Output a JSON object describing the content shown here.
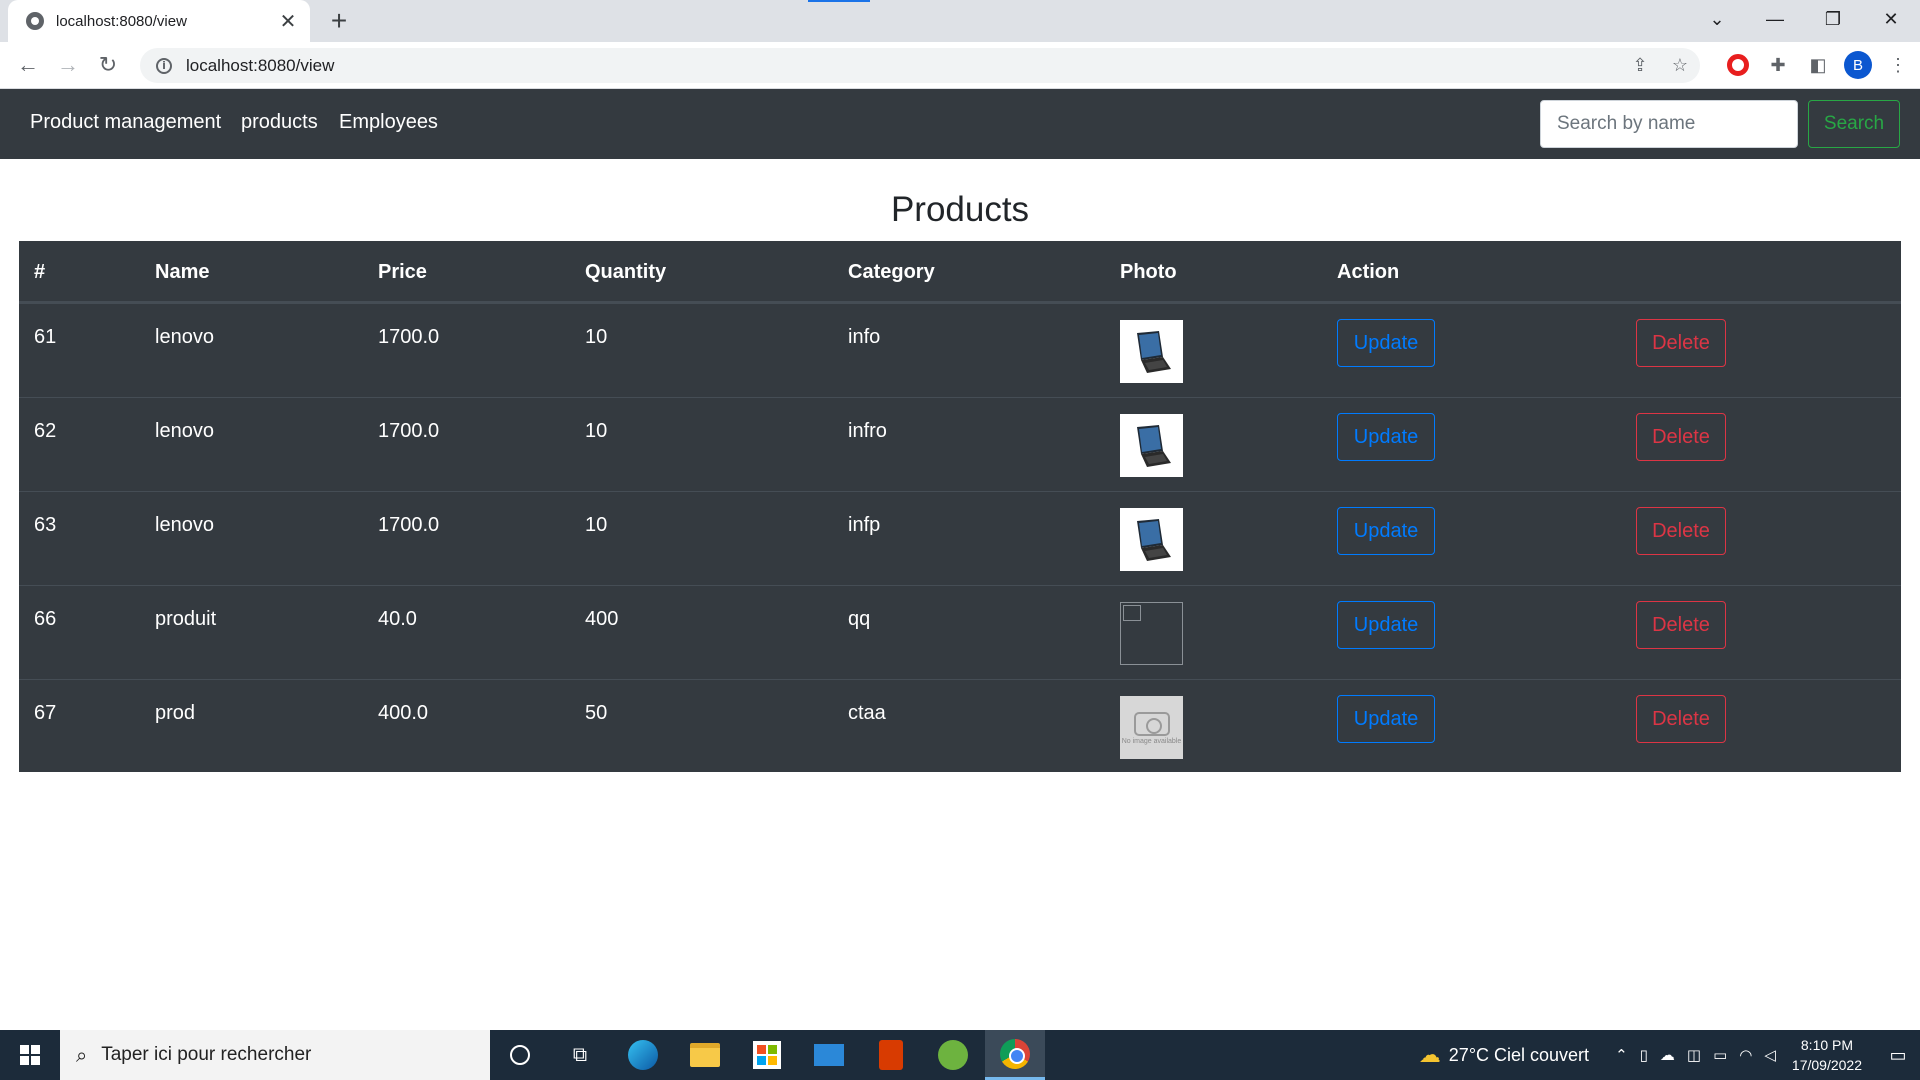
{
  "browser": {
    "tab_title": "localhost:8080/view",
    "tab_close": "✕",
    "new_tab": "+",
    "url": "localhost:8080/view",
    "window_controls": {
      "dropdown": "⌄",
      "minimize": "—",
      "restore": "❐",
      "close": "✕"
    },
    "profile_initial": "B"
  },
  "navbar": {
    "brand": "Product management",
    "links": [
      "products",
      "Employees"
    ],
    "search_placeholder": "Search by name",
    "search_button": "Search"
  },
  "page": {
    "title": "Products",
    "columns": [
      "#",
      "Name",
      "Price",
      "Quantity",
      "Category",
      "Photo",
      "Action"
    ],
    "rows": [
      {
        "id": "61",
        "name": "lenovo",
        "price": "1700.0",
        "quantity": "10",
        "category": "info",
        "photo": "laptop"
      },
      {
        "id": "62",
        "name": "lenovo",
        "price": "1700.0",
        "quantity": "10",
        "category": "infro",
        "photo": "laptop"
      },
      {
        "id": "63",
        "name": "lenovo",
        "price": "1700.0",
        "quantity": "10",
        "category": "infp",
        "photo": "laptop"
      },
      {
        "id": "66",
        "name": "produit",
        "price": "40.0",
        "quantity": "400",
        "category": "qq",
        "photo": "broken"
      },
      {
        "id": "67",
        "name": "prod",
        "price": "400.0",
        "quantity": "50",
        "category": "ctaa",
        "photo": "no-image"
      }
    ],
    "update_label": "Update",
    "delete_label": "Delete",
    "no_image_text": "No image available"
  },
  "taskbar": {
    "search_placeholder": "Taper ici pour rechercher",
    "weather": "27°C  Ciel couvert",
    "time": "8:10 PM",
    "date": "17/09/2022"
  },
  "colors": {
    "navbar_bg": "#343a40",
    "table_bg": "#343a40",
    "update": "#007bff",
    "delete": "#dc3545",
    "search": "#28a745"
  }
}
